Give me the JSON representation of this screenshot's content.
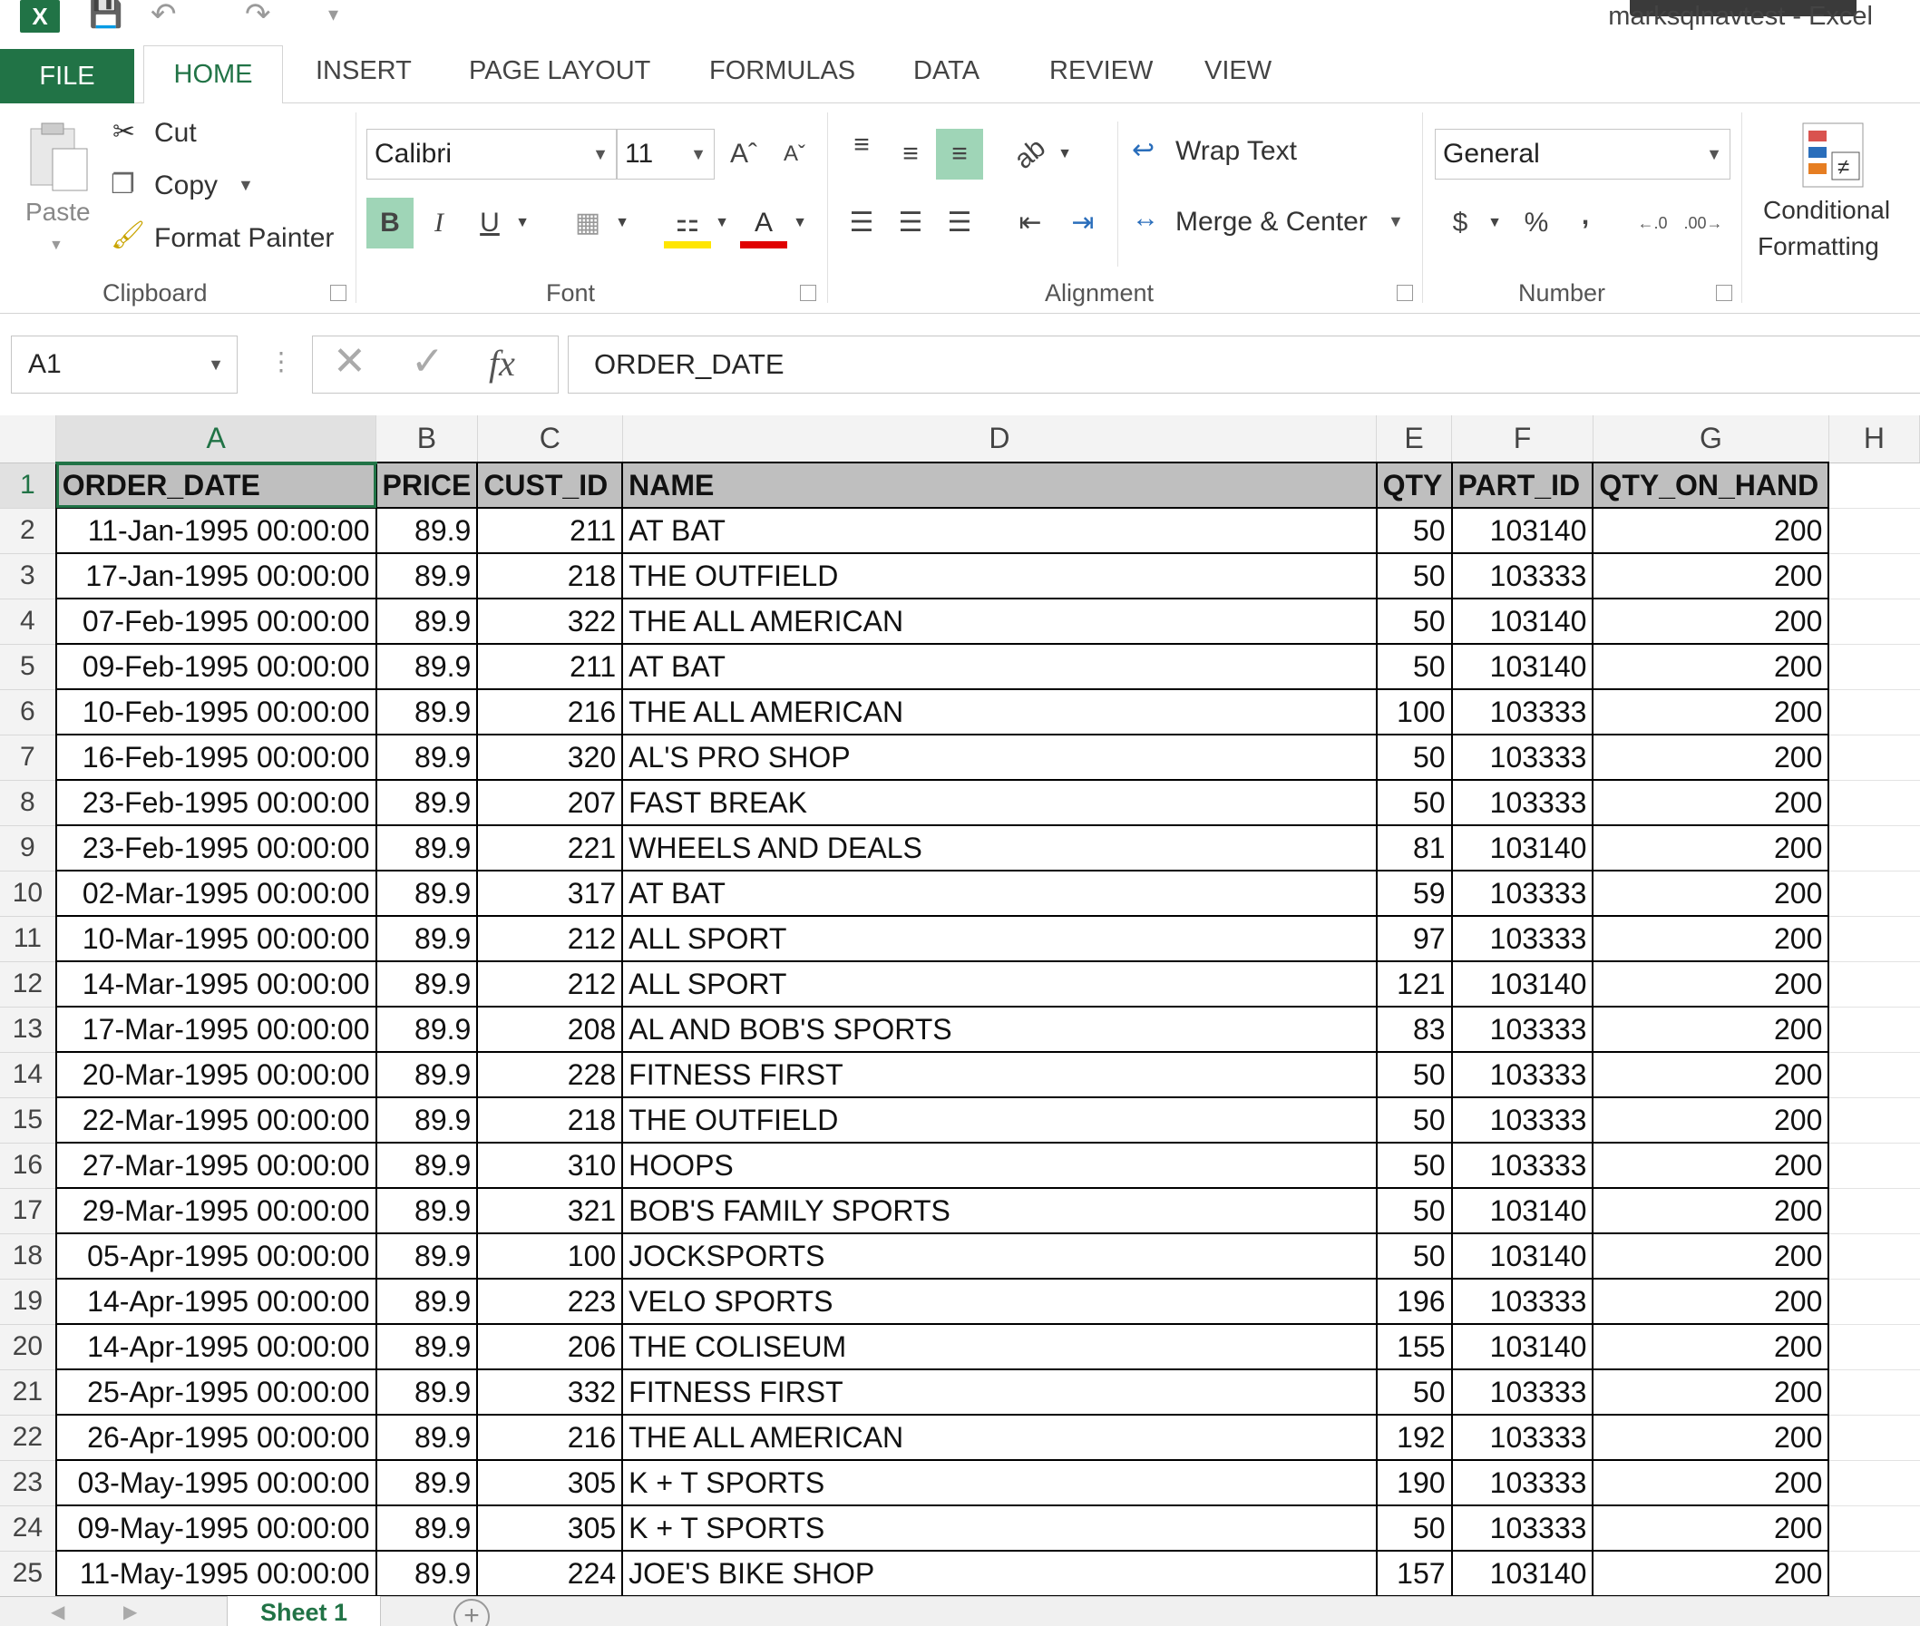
{
  "app": {
    "title": "marksqlnavtest - Excel"
  },
  "tabs": [
    "FILE",
    "HOME",
    "INSERT",
    "PAGE LAYOUT",
    "FORMULAS",
    "DATA",
    "REVIEW",
    "VIEW"
  ],
  "ribbon": {
    "clipboard": {
      "label": "Clipboard",
      "paste": "Paste",
      "cut": "Cut",
      "copy": "Copy",
      "format_painter": "Format Painter"
    },
    "font": {
      "label": "Font",
      "family": "Calibri",
      "size": "11",
      "bold": "B",
      "italic": "I",
      "underline": "U"
    },
    "alignment": {
      "label": "Alignment",
      "wrap_text": "Wrap Text",
      "merge_center": "Merge & Center"
    },
    "number": {
      "label": "Number",
      "format": "General",
      "currency": "$",
      "percent": "%",
      "comma": ","
    },
    "styles": {
      "conditional_line1": "Conditional",
      "conditional_line2": "Formatting"
    }
  },
  "formula_bar": {
    "name_box": "A1",
    "fx": "fx",
    "content": "ORDER_DATE"
  },
  "columns": [
    "A",
    "B",
    "C",
    "D",
    "E",
    "F",
    "G",
    "H"
  ],
  "header_row": [
    "ORDER_DATE",
    "PRICE",
    "CUST_ID",
    "NAME",
    "QTY",
    "PART_ID",
    "QTY_ON_HAND"
  ],
  "rows": [
    [
      "11-Jan-1995 00:00:00",
      "89.9",
      "211",
      "AT BAT",
      "50",
      "103140",
      "200"
    ],
    [
      "17-Jan-1995 00:00:00",
      "89.9",
      "218",
      "THE OUTFIELD",
      "50",
      "103333",
      "200"
    ],
    [
      "07-Feb-1995 00:00:00",
      "89.9",
      "322",
      "THE ALL AMERICAN",
      "50",
      "103140",
      "200"
    ],
    [
      "09-Feb-1995 00:00:00",
      "89.9",
      "211",
      "AT BAT",
      "50",
      "103140",
      "200"
    ],
    [
      "10-Feb-1995 00:00:00",
      "89.9",
      "216",
      "THE ALL AMERICAN",
      "100",
      "103333",
      "200"
    ],
    [
      "16-Feb-1995 00:00:00",
      "89.9",
      "320",
      "AL'S PRO SHOP",
      "50",
      "103333",
      "200"
    ],
    [
      "23-Feb-1995 00:00:00",
      "89.9",
      "207",
      "FAST BREAK",
      "50",
      "103333",
      "200"
    ],
    [
      "23-Feb-1995 00:00:00",
      "89.9",
      "221",
      "WHEELS AND DEALS",
      "81",
      "103140",
      "200"
    ],
    [
      "02-Mar-1995 00:00:00",
      "89.9",
      "317",
      "AT BAT",
      "59",
      "103333",
      "200"
    ],
    [
      "10-Mar-1995 00:00:00",
      "89.9",
      "212",
      "ALL SPORT",
      "97",
      "103333",
      "200"
    ],
    [
      "14-Mar-1995 00:00:00",
      "89.9",
      "212",
      "ALL SPORT",
      "121",
      "103140",
      "200"
    ],
    [
      "17-Mar-1995 00:00:00",
      "89.9",
      "208",
      "AL AND BOB'S SPORTS",
      "83",
      "103333",
      "200"
    ],
    [
      "20-Mar-1995 00:00:00",
      "89.9",
      "228",
      "FITNESS FIRST",
      "50",
      "103333",
      "200"
    ],
    [
      "22-Mar-1995 00:00:00",
      "89.9",
      "218",
      "THE OUTFIELD",
      "50",
      "103333",
      "200"
    ],
    [
      "27-Mar-1995 00:00:00",
      "89.9",
      "310",
      "HOOPS",
      "50",
      "103333",
      "200"
    ],
    [
      "29-Mar-1995 00:00:00",
      "89.9",
      "321",
      "BOB'S FAMILY SPORTS",
      "50",
      "103140",
      "200"
    ],
    [
      "05-Apr-1995 00:00:00",
      "89.9",
      "100",
      "JOCKSPORTS",
      "50",
      "103140",
      "200"
    ],
    [
      "14-Apr-1995 00:00:00",
      "89.9",
      "223",
      "VELO SPORTS",
      "196",
      "103333",
      "200"
    ],
    [
      "14-Apr-1995 00:00:00",
      "89.9",
      "206",
      "THE COLISEUM",
      "155",
      "103140",
      "200"
    ],
    [
      "25-Apr-1995 00:00:00",
      "89.9",
      "332",
      "FITNESS FIRST",
      "50",
      "103333",
      "200"
    ],
    [
      "26-Apr-1995 00:00:00",
      "89.9",
      "216",
      "THE ALL AMERICAN",
      "192",
      "103333",
      "200"
    ],
    [
      "03-May-1995 00:00:00",
      "89.9",
      "305",
      "K + T SPORTS",
      "190",
      "103333",
      "200"
    ],
    [
      "09-May-1995 00:00:00",
      "89.9",
      "305",
      "K + T SPORTS",
      "50",
      "103333",
      "200"
    ],
    [
      "11-May-1995 00:00:00",
      "89.9",
      "224",
      "JOE'S BIKE SHOP",
      "157",
      "103140",
      "200"
    ]
  ],
  "sheet_tabs": [
    "Sheet 1"
  ],
  "colors": {
    "accent": "#217346",
    "header_fill": "#bfbfbf",
    "active_button": "#9fd5b7"
  }
}
